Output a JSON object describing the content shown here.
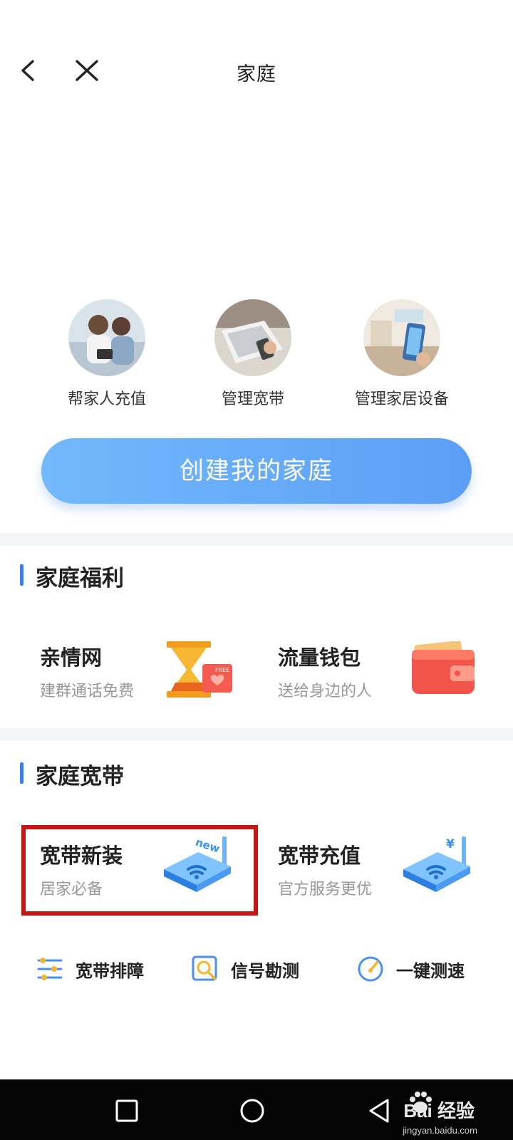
{
  "header": {
    "title": "家庭"
  },
  "features": [
    {
      "label": "帮家人充值",
      "icon": "family-photo"
    },
    {
      "label": "管理宽带",
      "icon": "laptop-photo"
    },
    {
      "label": "管理家居设备",
      "icon": "smart-home-photo"
    }
  ],
  "create_button": {
    "label": "创建我的家庭"
  },
  "benefits": {
    "title": "家庭福利",
    "items": [
      {
        "title": "亲情网",
        "subtitle": "建群通话免费",
        "icon": "hourglass-icon"
      },
      {
        "title": "流量钱包",
        "subtitle": "送给身边的人",
        "icon": "wallet-icon"
      }
    ]
  },
  "broadband": {
    "title": "家庭宽带",
    "items": [
      {
        "title": "宽带新装",
        "subtitle": "居家必备",
        "icon": "router-new-icon",
        "badge": "new"
      },
      {
        "title": "宽带充值",
        "subtitle": "官方服务更优",
        "icon": "router-recharge-icon",
        "badge": "¥"
      }
    ],
    "tools": [
      {
        "label": "宽带排障",
        "icon": "sliders-icon"
      },
      {
        "label": "信号勘测",
        "icon": "signal-search-icon"
      },
      {
        "label": "一键测速",
        "icon": "speed-gauge-icon"
      }
    ]
  },
  "watermark": {
    "text": "Bai 经验",
    "url": "jingyan.baidu.com"
  },
  "colors": {
    "accent": "#3b7ef0",
    "button_start": "#72b9fb",
    "button_end": "#5c9ef6",
    "highlight": "#c41616",
    "navbar": "#050505"
  }
}
